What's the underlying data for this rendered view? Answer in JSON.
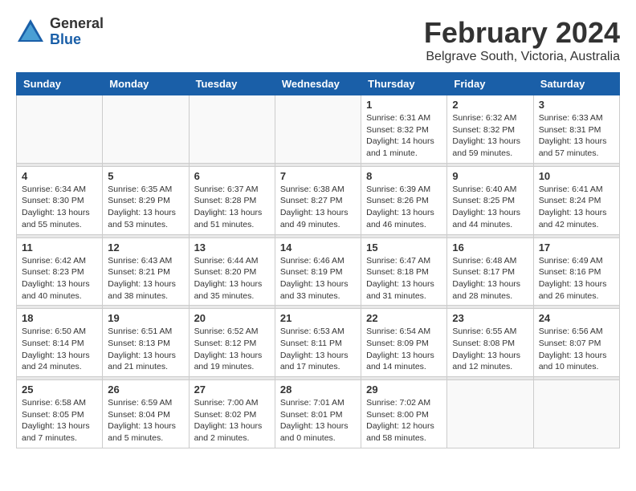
{
  "logo": {
    "general": "General",
    "blue": "Blue"
  },
  "title": "February 2024",
  "subtitle": "Belgrave South, Victoria, Australia",
  "days_of_week": [
    "Sunday",
    "Monday",
    "Tuesday",
    "Wednesday",
    "Thursday",
    "Friday",
    "Saturday"
  ],
  "weeks": [
    {
      "days": [
        {
          "num": "",
          "info": ""
        },
        {
          "num": "",
          "info": ""
        },
        {
          "num": "",
          "info": ""
        },
        {
          "num": "",
          "info": ""
        },
        {
          "num": "1",
          "info": "Sunrise: 6:31 AM\nSunset: 8:32 PM\nDaylight: 14 hours\nand 1 minute."
        },
        {
          "num": "2",
          "info": "Sunrise: 6:32 AM\nSunset: 8:32 PM\nDaylight: 13 hours\nand 59 minutes."
        },
        {
          "num": "3",
          "info": "Sunrise: 6:33 AM\nSunset: 8:31 PM\nDaylight: 13 hours\nand 57 minutes."
        }
      ]
    },
    {
      "days": [
        {
          "num": "4",
          "info": "Sunrise: 6:34 AM\nSunset: 8:30 PM\nDaylight: 13 hours\nand 55 minutes."
        },
        {
          "num": "5",
          "info": "Sunrise: 6:35 AM\nSunset: 8:29 PM\nDaylight: 13 hours\nand 53 minutes."
        },
        {
          "num": "6",
          "info": "Sunrise: 6:37 AM\nSunset: 8:28 PM\nDaylight: 13 hours\nand 51 minutes."
        },
        {
          "num": "7",
          "info": "Sunrise: 6:38 AM\nSunset: 8:27 PM\nDaylight: 13 hours\nand 49 minutes."
        },
        {
          "num": "8",
          "info": "Sunrise: 6:39 AM\nSunset: 8:26 PM\nDaylight: 13 hours\nand 46 minutes."
        },
        {
          "num": "9",
          "info": "Sunrise: 6:40 AM\nSunset: 8:25 PM\nDaylight: 13 hours\nand 44 minutes."
        },
        {
          "num": "10",
          "info": "Sunrise: 6:41 AM\nSunset: 8:24 PM\nDaylight: 13 hours\nand 42 minutes."
        }
      ]
    },
    {
      "days": [
        {
          "num": "11",
          "info": "Sunrise: 6:42 AM\nSunset: 8:23 PM\nDaylight: 13 hours\nand 40 minutes."
        },
        {
          "num": "12",
          "info": "Sunrise: 6:43 AM\nSunset: 8:21 PM\nDaylight: 13 hours\nand 38 minutes."
        },
        {
          "num": "13",
          "info": "Sunrise: 6:44 AM\nSunset: 8:20 PM\nDaylight: 13 hours\nand 35 minutes."
        },
        {
          "num": "14",
          "info": "Sunrise: 6:46 AM\nSunset: 8:19 PM\nDaylight: 13 hours\nand 33 minutes."
        },
        {
          "num": "15",
          "info": "Sunrise: 6:47 AM\nSunset: 8:18 PM\nDaylight: 13 hours\nand 31 minutes."
        },
        {
          "num": "16",
          "info": "Sunrise: 6:48 AM\nSunset: 8:17 PM\nDaylight: 13 hours\nand 28 minutes."
        },
        {
          "num": "17",
          "info": "Sunrise: 6:49 AM\nSunset: 8:16 PM\nDaylight: 13 hours\nand 26 minutes."
        }
      ]
    },
    {
      "days": [
        {
          "num": "18",
          "info": "Sunrise: 6:50 AM\nSunset: 8:14 PM\nDaylight: 13 hours\nand 24 minutes."
        },
        {
          "num": "19",
          "info": "Sunrise: 6:51 AM\nSunset: 8:13 PM\nDaylight: 13 hours\nand 21 minutes."
        },
        {
          "num": "20",
          "info": "Sunrise: 6:52 AM\nSunset: 8:12 PM\nDaylight: 13 hours\nand 19 minutes."
        },
        {
          "num": "21",
          "info": "Sunrise: 6:53 AM\nSunset: 8:11 PM\nDaylight: 13 hours\nand 17 minutes."
        },
        {
          "num": "22",
          "info": "Sunrise: 6:54 AM\nSunset: 8:09 PM\nDaylight: 13 hours\nand 14 minutes."
        },
        {
          "num": "23",
          "info": "Sunrise: 6:55 AM\nSunset: 8:08 PM\nDaylight: 13 hours\nand 12 minutes."
        },
        {
          "num": "24",
          "info": "Sunrise: 6:56 AM\nSunset: 8:07 PM\nDaylight: 13 hours\nand 10 minutes."
        }
      ]
    },
    {
      "days": [
        {
          "num": "25",
          "info": "Sunrise: 6:58 AM\nSunset: 8:05 PM\nDaylight: 13 hours\nand 7 minutes."
        },
        {
          "num": "26",
          "info": "Sunrise: 6:59 AM\nSunset: 8:04 PM\nDaylight: 13 hours\nand 5 minutes."
        },
        {
          "num": "27",
          "info": "Sunrise: 7:00 AM\nSunset: 8:02 PM\nDaylight: 13 hours\nand 2 minutes."
        },
        {
          "num": "28",
          "info": "Sunrise: 7:01 AM\nSunset: 8:01 PM\nDaylight: 13 hours\nand 0 minutes."
        },
        {
          "num": "29",
          "info": "Sunrise: 7:02 AM\nSunset: 8:00 PM\nDaylight: 12 hours\nand 58 minutes."
        },
        {
          "num": "",
          "info": ""
        },
        {
          "num": "",
          "info": ""
        }
      ]
    }
  ]
}
